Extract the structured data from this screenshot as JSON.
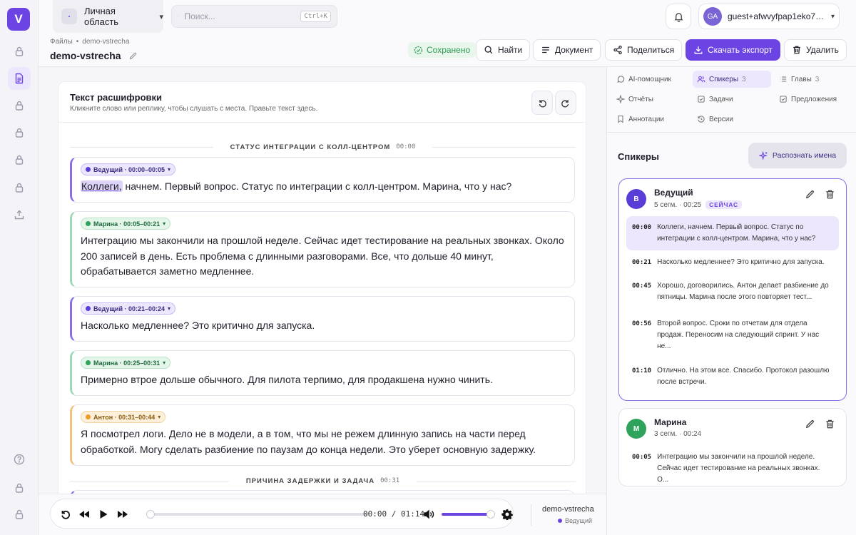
{
  "app": {
    "logo_letter": "V"
  },
  "topbar": {
    "workspace": "Личная область",
    "search_placeholder": "Поиск...",
    "search_shortcut": "Ctrl+K",
    "user": {
      "initials": "GA",
      "name": "guest+afwvyfpap1eko7d..."
    }
  },
  "doc": {
    "breadcrumb": [
      "Файлы",
      "•",
      "demo-vstrecha"
    ],
    "title": "demo-vstrecha",
    "saved_label": "Сохранено",
    "buttons": {
      "find": "Найти",
      "document": "Документ",
      "share": "Поделиться",
      "export": "Скачать экспорт",
      "delete": "Удалить"
    }
  },
  "transcript": {
    "title": "Текст расшифровки",
    "subtitle": "Кликните слово или реплику, чтобы слушать с места. Правьте текст здесь.",
    "sections": [
      {
        "title": "Статус интеграции с колл-центром",
        "time": "00:00"
      },
      {
        "title": "Причина задержки и задача",
        "time": "00:31"
      }
    ],
    "turns": [
      {
        "speaker": "Ведущий · 00:00–00:05",
        "highlight": "Коллеги,",
        "text": " начнем. Первый вопрос. Статус по интеграции с колл-центром. Марина, что у нас?"
      },
      {
        "speaker": "Марина · 00:05–00:21",
        "text": "Интеграцию мы закончили на прошлой неделе. Сейчас идет тестирование на реальных звонках. Около 200 записей в день. Есть проблема с длинными разговорами. Все, что дольше 40 минут, обрабатывается заметно медленнее."
      },
      {
        "speaker": "Ведущий · 00:21–00:24",
        "text": "Насколько медленнее? Это критично для запуска."
      },
      {
        "speaker": "Марина · 00:25–00:31",
        "text": "Примерно втрое дольше обычного. Для пилота терпимо, для продакшена нужно чинить."
      },
      {
        "speaker": "Антон · 00:31–00:44",
        "text": "Я посмотрел логи. Дело не в модели, а в том, что мы не режем длинную запись на части перед обработкой. Могу сделать разбиение по паузам до конца недели. Это уберет основную задержку."
      }
    ]
  },
  "player": {
    "current": "00:00",
    "separator": "/",
    "duration": "01:14",
    "progress": 0,
    "volume": 1,
    "file_name": "demo-vstrecha",
    "speaker": "Ведущий"
  },
  "right_panel": {
    "tabs": [
      {
        "label": "AI-помощник",
        "count": ""
      },
      {
        "label": "Спикеры",
        "count": "3"
      },
      {
        "label": "Главы",
        "count": "3"
      },
      {
        "label": "Отчёты",
        "count": ""
      },
      {
        "label": "Задачи",
        "count": ""
      },
      {
        "label": "Предложения",
        "count": ""
      },
      {
        "label": "Аннотации",
        "count": ""
      },
      {
        "label": "Версии",
        "count": ""
      }
    ],
    "title": "Спикеры",
    "recognize_label": "Распознать имена",
    "speakers": [
      {
        "initial": "В",
        "name": "Ведущий",
        "meta": "5 сегм. · 00:25",
        "badge": "СЕЙЧАС",
        "color": "#5a3cd6",
        "utterances": [
          {
            "time": "00:00",
            "text": "Коллеги, начнем. Первый вопрос. Статус по интеграции с колл-центром. Марина, что у нас?"
          },
          {
            "time": "00:21",
            "text": "Насколько медленнее? Это критично для запуска."
          },
          {
            "time": "00:45",
            "text": "Хорошо, договорились. Антон делает разбиение до пятницы. Марина после этого повторяет тест..."
          },
          {
            "time": "00:56",
            "text": "Второй вопрос. Сроки по отчетам для отдела продаж. Переносим на следующий спринт. У нас не..."
          },
          {
            "time": "01:10",
            "text": "Отлично. На этом все. Спасибо. Протокол разошлю после встречи."
          }
        ]
      },
      {
        "initial": "М",
        "name": "Марина",
        "meta": "3 сегм. · 00:24",
        "badge": "",
        "color": "#2fa35c",
        "utterances": [
          {
            "time": "00:05",
            "text": "Интеграцию мы закончили на прошлой неделе. Сейчас идет тестирование на реальных звонках. О..."
          }
        ]
      }
    ]
  },
  "colors": {
    "accent": "#6d44e4",
    "host": "#5a3cd6",
    "marina": "#2fa35c",
    "anton": "#ef9c2a"
  }
}
